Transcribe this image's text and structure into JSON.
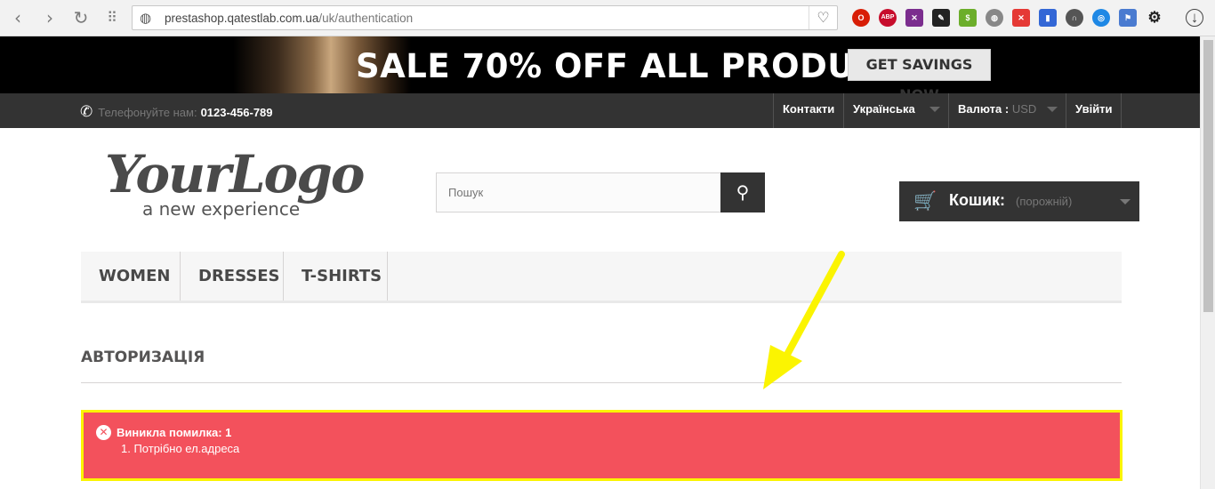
{
  "browser": {
    "url_host": "prestashop.qatestlab.com.ua",
    "url_path": "/uk/authentication",
    "nav_icons": [
      "back-icon",
      "forward-icon",
      "reload-icon",
      "speed-dial-icon"
    ],
    "extensions": [
      "opera-icon",
      "adblock-icon",
      "extension-icon",
      "note-icon",
      "extension-icon",
      "globe-icon",
      "shield-icon",
      "book-icon",
      "headphones-icon",
      "extension-icon",
      "extension-icon",
      "settings-icon",
      "download-icon"
    ]
  },
  "banner": {
    "headline": "SALE 70% OFF ALL PRODUCTS",
    "cta_label": "GET SAVINGS NOW"
  },
  "topnav": {
    "phone_label": "Телефонуйте нам:",
    "phone_number": "0123-456-789",
    "contacts": "Контакти",
    "language": "Українська",
    "currency_label": "Валюта :",
    "currency_value": "USD",
    "logout": "Увійти"
  },
  "header": {
    "logo_main": "YourLogo",
    "logo_tagline": "a new experience",
    "search_placeholder": "Пошук",
    "cart_label": "Кошик:",
    "cart_status": "(порожній)"
  },
  "menu": {
    "items": [
      "WOMEN",
      "DRESSES",
      "T-SHIRTS"
    ]
  },
  "page": {
    "title": "АВТОРИЗАЦІЯ"
  },
  "alert": {
    "title": "Виникла помилка: 1",
    "items": [
      "1. Потрібно ел.адреса"
    ]
  },
  "colors": {
    "alert_bg": "#f3515c",
    "alert_border": "#fbf401",
    "dark": "#333333",
    "annotation_arrow": "#fbf401"
  }
}
